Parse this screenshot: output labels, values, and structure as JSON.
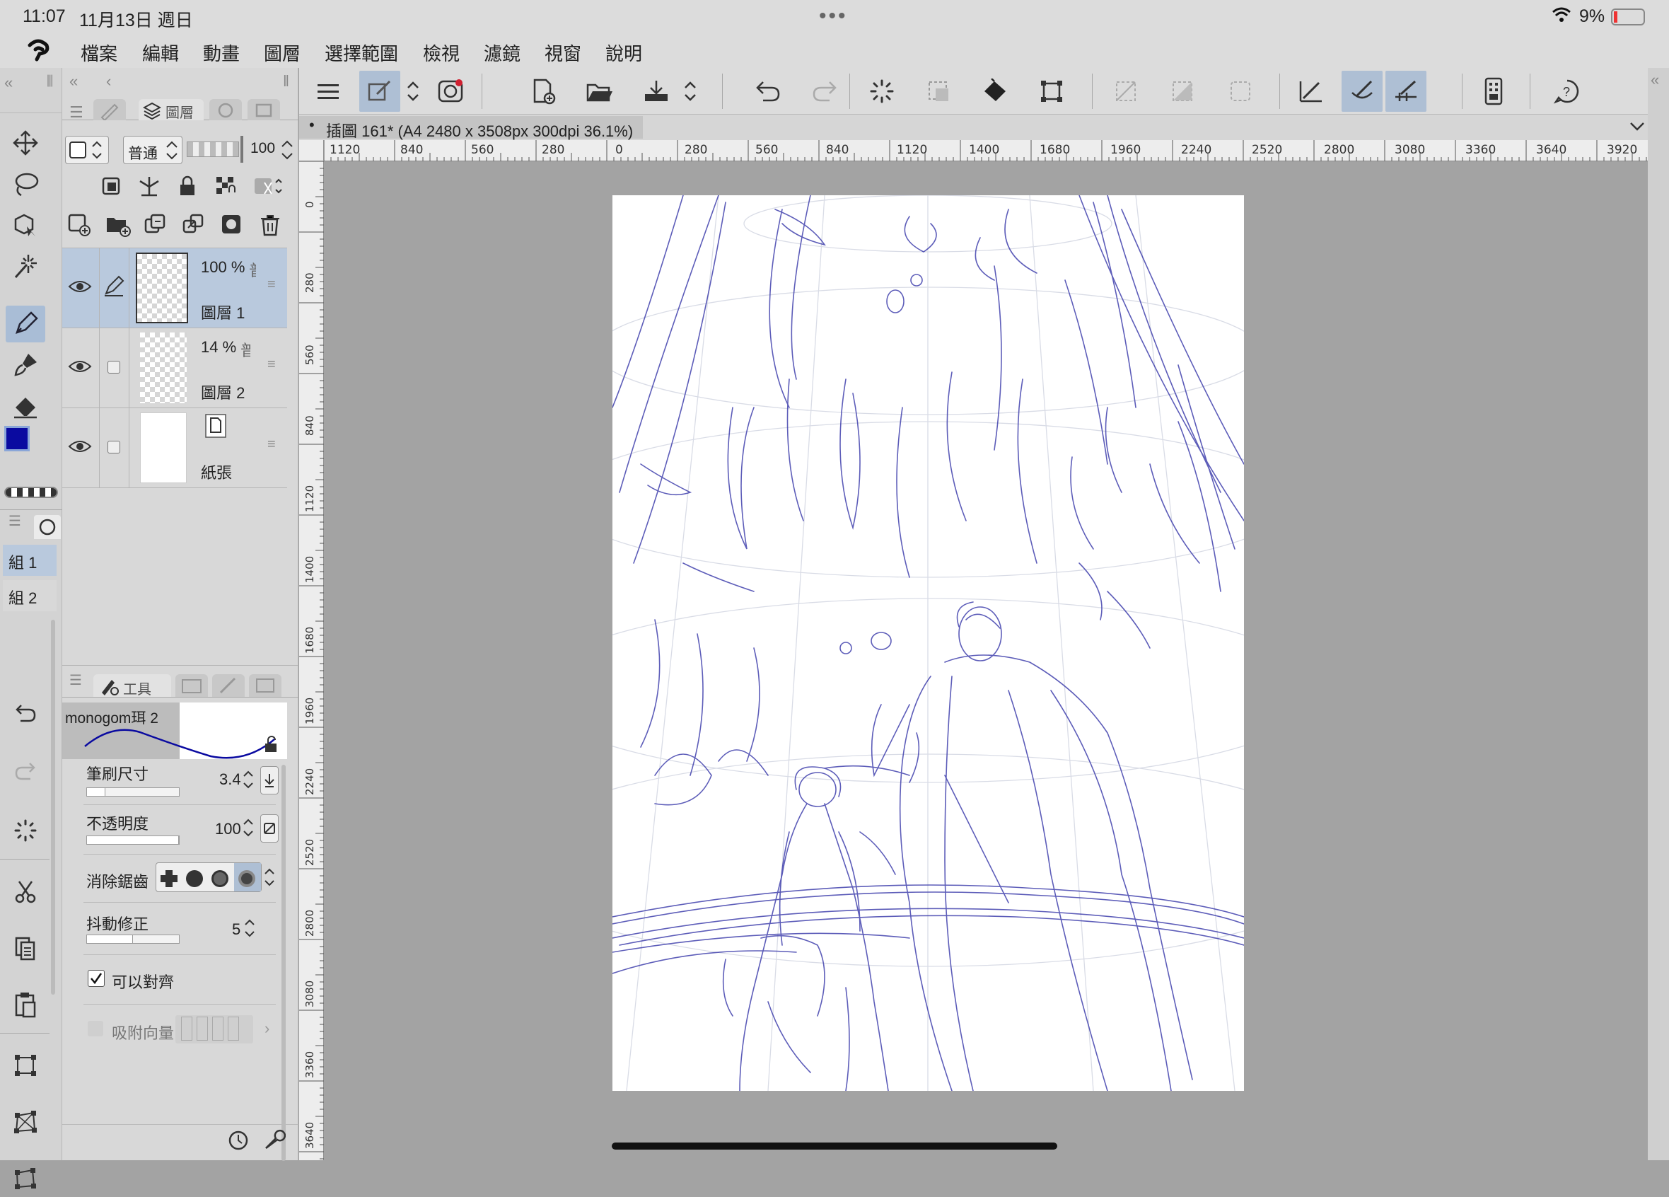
{
  "status_bar": {
    "time": "11:07",
    "date": "11月13日 週日",
    "battery": "9%"
  },
  "menu": {
    "items": [
      "檔案",
      "編輯",
      "動畫",
      "圖層",
      "選擇範圍",
      "檢視",
      "濾鏡",
      "視窗",
      "說明"
    ]
  },
  "document": {
    "tab_title": "插圖 161* (A4 2480 x 3508px 300dpi 36.1%)"
  },
  "ruler": {
    "top_ticks": [
      "1120",
      "840",
      "560",
      "280",
      "0",
      "280",
      "560",
      "840",
      "1120",
      "1400",
      "1680",
      "1960",
      "2240",
      "2520",
      "2800",
      "3080",
      "3360",
      "3640",
      "3920"
    ],
    "left_ticks": [
      "0",
      "280",
      "560",
      "840",
      "1120",
      "1400",
      "1680",
      "1960",
      "2240",
      "2520",
      "2800",
      "3080",
      "3360",
      "3640"
    ]
  },
  "layer_panel": {
    "tab_label": "圖層",
    "blend_mode": "普通",
    "opacity": "100",
    "layers": [
      {
        "opacity": "100 %",
        "mode": "普",
        "name": "圖層 1",
        "selected": true
      },
      {
        "opacity": "14 %",
        "mode": "普",
        "name": "圖層 2",
        "selected": false
      },
      {
        "opacity": "",
        "mode": "",
        "name": "紙張",
        "selected": false
      }
    ]
  },
  "groups": {
    "items": [
      "組 1",
      "組 2"
    ]
  },
  "tool_property": {
    "tab_label": "工具",
    "brush_name": "monogom珥 2",
    "brush_size_label": "筆刷尺寸",
    "brush_size_value": "3.4",
    "brush_size_fraction": 0.2,
    "opacity_label": "不透明度",
    "opacity_value": "100",
    "opacity_fraction": 1.0,
    "antialias_label": "消除鋸齒",
    "stabilization_label": "抖動修正",
    "stabilization_value": "5",
    "stabilization_fraction": 0.5,
    "snap_label": "可以對齊",
    "snap_checked": true,
    "vector_magnet_label": "吸附向量"
  },
  "colors": {
    "main_color": "#0a0aa0",
    "accent": "#aebfd4",
    "stroke": "#3a3aaa"
  },
  "icons": {
    "logo": "clip-studio-logo-icon",
    "tools": [
      "move-icon",
      "lasso-icon",
      "object-icon",
      "auto-select-icon",
      "pen-icon",
      "brush-icon",
      "eraser-icon"
    ]
  }
}
